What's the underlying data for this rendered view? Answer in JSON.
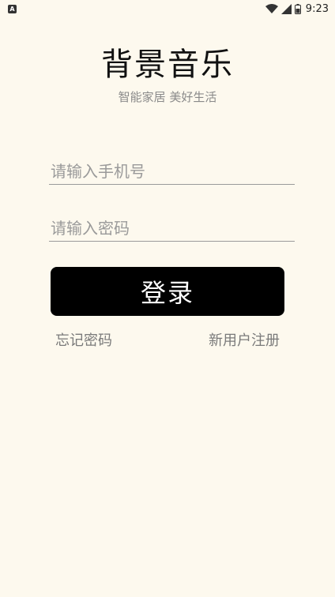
{
  "status_bar": {
    "notification_icon": "app-notification-icon",
    "notification_glyph": "A",
    "time": "9:23",
    "icons": [
      "wifi-icon",
      "cell-signal-icon",
      "battery-icon"
    ]
  },
  "app": {
    "title": "背景音乐",
    "subtitle": "智能家居 美好生活"
  },
  "form": {
    "phone_placeholder": "请输入手机号",
    "phone_value": "",
    "password_placeholder": "请输入密码",
    "password_value": "",
    "login_label": "登录",
    "forgot_label": "忘记密码",
    "register_label": "新用户注册"
  },
  "colors": {
    "background": "#fdf9ee",
    "button": "#000000",
    "button_text": "#ffffff",
    "muted_text": "#7a7a7a"
  }
}
